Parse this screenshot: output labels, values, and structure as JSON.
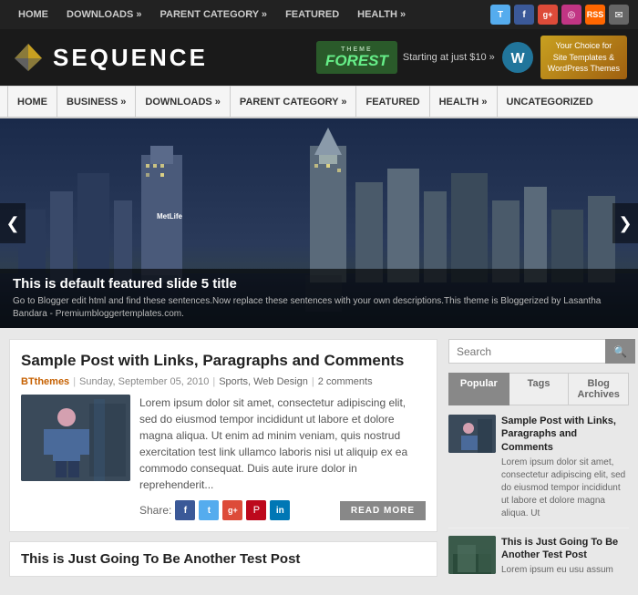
{
  "topnav": {
    "links": [
      "HOME",
      "DOWNLOADS »",
      "PARENT CATEGORY »",
      "FEATURED",
      "HEALTH »"
    ]
  },
  "social": {
    "twitter": "T",
    "facebook": "f",
    "gplus": "g+",
    "instagram": "📷",
    "rss": "RSS",
    "email": "✉"
  },
  "header": {
    "logo_text": "SEQUENCE",
    "ad_theme": "THEME",
    "ad_forest": "FOREST",
    "ad_starting": "Starting at just $10 »",
    "ad_right_line1": "Your Choice for",
    "ad_right_line2": "Site Templates &",
    "ad_right_line3": "WordPress Themes"
  },
  "mainnav": {
    "links": [
      "HOME",
      "BUSINESS »",
      "DOWNLOADS »",
      "PARENT CATEGORY »",
      "FEATURED",
      "HEALTH »",
      "UNCATEGORIZED"
    ]
  },
  "slider": {
    "title": "This is default featured slide 5 title",
    "desc": "Go to Blogger edit html and find these sentences.Now replace these sentences with your own descriptions.This theme is Bloggerized by Lasantha Bandara - Premiumbloggertemplates.com.",
    "prev": "❮",
    "next": "❯",
    "metlife_label": "MetLife"
  },
  "post1": {
    "title": "Sample Post with Links, Paragraphs and Comments",
    "author": "BTthemes",
    "date": "Sunday, September 05, 2010",
    "categories": "Sports, Web Design",
    "comments": "2 comments",
    "body": "Lorem ipsum dolor sit amet, consectetur adipiscing elit, sed do eiusmod tempor incididunt ut labore et dolore magna aliqua. Ut enim ad minim veniam, quis nostrud exercitation test link ullamco laboris nisi ut aliquip ex ea commodo consequat. Duis aute irure dolor in reprehenderit...",
    "share_label": "Share:",
    "read_more": "READ MORE"
  },
  "post2": {
    "title": "This is Just Going To Be Another Test Post"
  },
  "sidebar": {
    "search_placeholder": "Search",
    "tabs": [
      "Popular",
      "Tags",
      "Blog Archives"
    ],
    "active_tab": 0,
    "posts": [
      {
        "title": "Sample Post with Links, Paragraphs and Comments",
        "excerpt": "Lorem ipsum dolor sit amet, consectetur adipiscing elit, sed do eiusmod tempor incididunt ut labore et dolore magna aliqua. Ut"
      },
      {
        "title": "This is Just Going To Be Another Test Post",
        "excerpt": "Lorem ipsum eu usu assum"
      }
    ]
  }
}
